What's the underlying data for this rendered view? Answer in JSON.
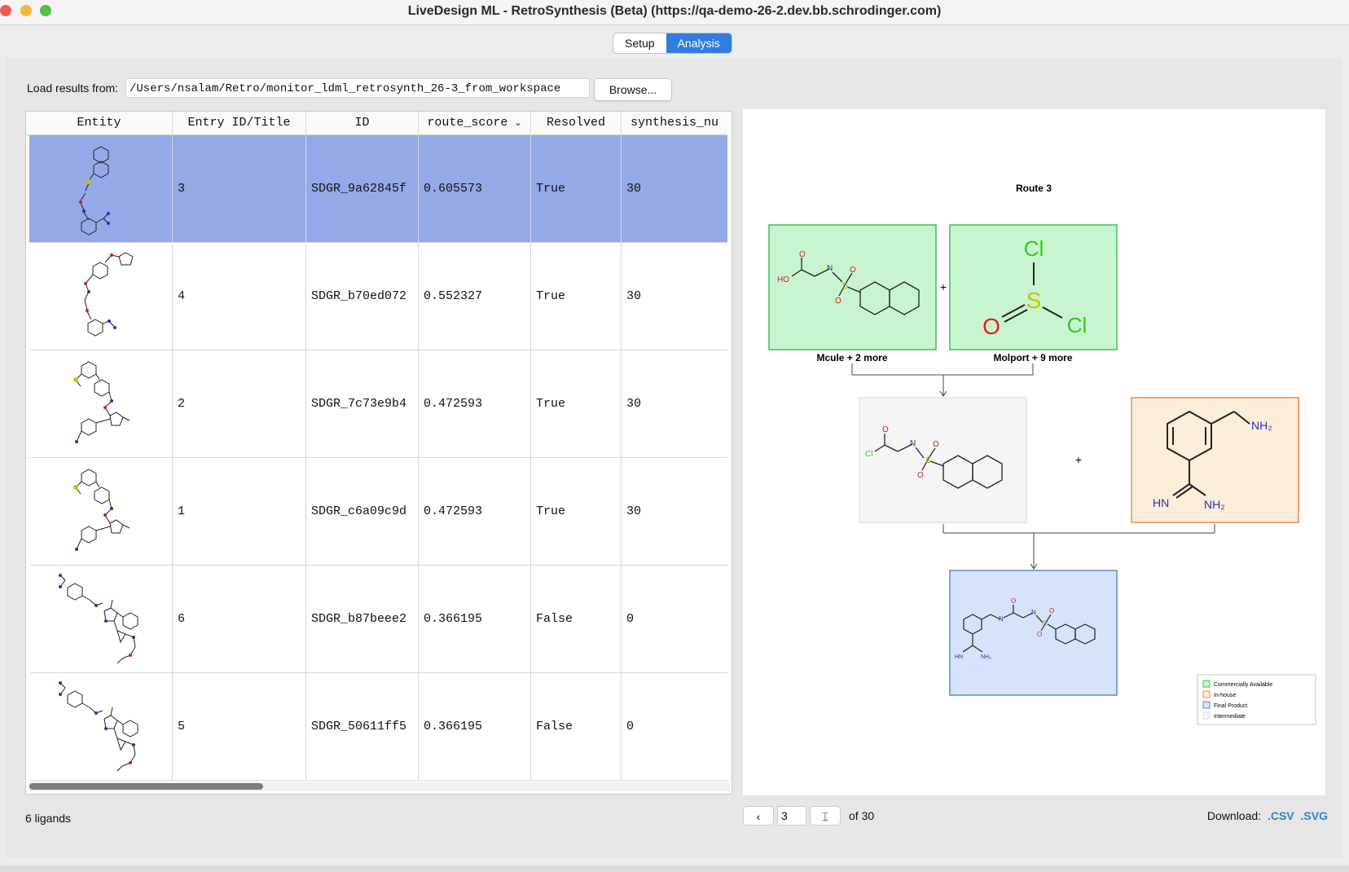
{
  "window": {
    "title": "LiveDesign ML - RetroSynthesis (Beta) (https://qa-demo-26-2.dev.bb.schrodinger.com)"
  },
  "tabs": [
    {
      "label": "Setup",
      "active": false
    },
    {
      "label": "Analysis",
      "active": true
    }
  ],
  "load": {
    "label": "Load results from:",
    "path": "/Users/nsalam/Retro/monitor_ldml_retrosynth_26-3_from_workspace",
    "browse_label": "Browse..."
  },
  "table": {
    "columns": [
      "Entity",
      "Entry ID/Title",
      "ID",
      "route_score",
      "Resolved",
      "synthesis_nu"
    ],
    "sort_indicator": "chevron-down-icon",
    "rows": [
      {
        "entry": "3",
        "id": "SDGR_9a62845f",
        "score": "0.605573",
        "resolved": "True",
        "synthesis": "30",
        "selected": true
      },
      {
        "entry": "4",
        "id": "SDGR_b70ed072",
        "score": "0.552327",
        "resolved": "True",
        "synthesis": "30",
        "selected": false
      },
      {
        "entry": "2",
        "id": "SDGR_7c73e9b4",
        "score": "0.472593",
        "resolved": "True",
        "synthesis": "30",
        "selected": false
      },
      {
        "entry": "1",
        "id": "SDGR_c6a09c9d",
        "score": "0.472593",
        "resolved": "True",
        "synthesis": "30",
        "selected": false
      },
      {
        "entry": "6",
        "id": "SDGR_b87beee2",
        "score": "0.366195",
        "resolved": "False",
        "synthesis": "0",
        "selected": false
      },
      {
        "entry": "5",
        "id": "SDGR_50611ff5",
        "score": "0.366195",
        "resolved": "False",
        "synthesis": "0",
        "selected": false
      }
    ]
  },
  "status": {
    "ligands": "6 ligands"
  },
  "route": {
    "title": "Route 3",
    "plus": "+",
    "sources": [
      "Mcule + 2 more",
      "Molport + 9 more"
    ],
    "labels": {
      "cl": "Cl",
      "s": "S",
      "o": "O",
      "nh2": "NH₂",
      "hn": "HN",
      "ho": "HO",
      "n": "N"
    },
    "legend": [
      "Commercially Available",
      "In-house",
      "Final Product",
      "Intermediate"
    ],
    "colors": {
      "commercial": "#c8f5cf",
      "inhouse": "#fdeeda",
      "final": "#d6e3fb",
      "intermediate": "#f5f5f5"
    }
  },
  "pager": {
    "prev": "‹",
    "value": "3",
    "of_label": "of 30"
  },
  "download": {
    "label": "Download:",
    "csv": ".CSV",
    "svg": ".SVG"
  },
  "colors": {
    "accent": "#2f7de1",
    "selected_row": "#94a9e8",
    "link": "#2b86c5"
  }
}
